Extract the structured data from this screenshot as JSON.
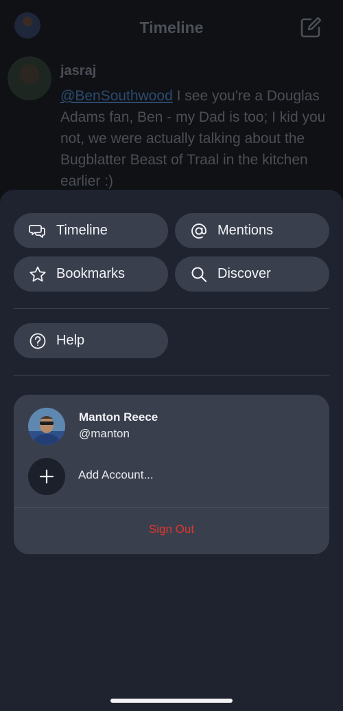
{
  "nav": {
    "title": "Timeline"
  },
  "post": {
    "username": "jasraj",
    "mention": "@BenSouthwood",
    "text": " I see you're a Douglas Adams fan, Ben - my Dad is too; I kid you not, we were actually talking about the Bugblatter Beast of Traal in the kitchen earlier :)"
  },
  "menu": {
    "items": [
      {
        "label": "Timeline",
        "icon": "chat-bubbles-icon"
      },
      {
        "label": "Mentions",
        "icon": "at-sign-icon"
      },
      {
        "label": "Bookmarks",
        "icon": "star-icon"
      },
      {
        "label": "Discover",
        "icon": "search-icon"
      }
    ],
    "help": {
      "label": "Help",
      "icon": "question-circle-icon"
    }
  },
  "account": {
    "name": "Manton Reece",
    "handle": "@manton",
    "add_label": "Add Account...",
    "sign_out_label": "Sign Out"
  },
  "colors": {
    "sheet_bg": "#1f2330",
    "pill_bg": "#3a3f4e",
    "sign_out": "#e0362c",
    "link": "#2c4a6e"
  }
}
